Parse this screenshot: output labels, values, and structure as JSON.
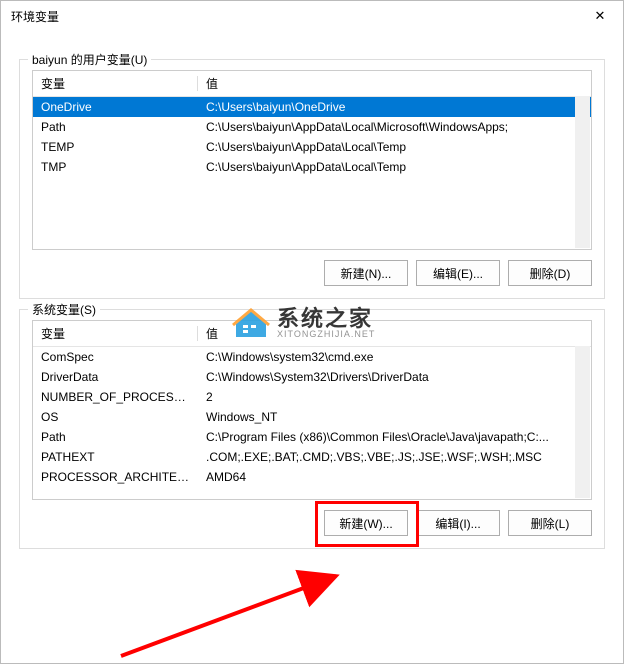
{
  "window": {
    "title": "环境变量"
  },
  "user_group": {
    "title": "baiyun 的用户变量(U)",
    "headers": {
      "var": "变量",
      "val": "值"
    },
    "rows": [
      {
        "var": "OneDrive",
        "val": "C:\\Users\\baiyun\\OneDrive",
        "selected": true
      },
      {
        "var": "Path",
        "val": "C:\\Users\\baiyun\\AppData\\Local\\Microsoft\\WindowsApps;"
      },
      {
        "var": "TEMP",
        "val": "C:\\Users\\baiyun\\AppData\\Local\\Temp"
      },
      {
        "var": "TMP",
        "val": "C:\\Users\\baiyun\\AppData\\Local\\Temp"
      }
    ],
    "buttons": {
      "new": "新建(N)...",
      "edit": "编辑(E)...",
      "del": "删除(D)"
    }
  },
  "sys_group": {
    "title": "系统变量(S)",
    "headers": {
      "var": "变量",
      "val": "值"
    },
    "rows": [
      {
        "var": "ComSpec",
        "val": "C:\\Windows\\system32\\cmd.exe"
      },
      {
        "var": "DriverData",
        "val": "C:\\Windows\\System32\\Drivers\\DriverData"
      },
      {
        "var": "NUMBER_OF_PROCESSORS",
        "val": "2"
      },
      {
        "var": "OS",
        "val": "Windows_NT"
      },
      {
        "var": "Path",
        "val": "C:\\Program Files (x86)\\Common Files\\Oracle\\Java\\javapath;C:..."
      },
      {
        "var": "PATHEXT",
        "val": ".COM;.EXE;.BAT;.CMD;.VBS;.VBE;.JS;.JSE;.WSF;.WSH;.MSC"
      },
      {
        "var": "PROCESSOR_ARCHITECT...",
        "val": "AMD64"
      }
    ],
    "buttons": {
      "new": "新建(W)...",
      "edit": "编辑(I)...",
      "del": "删除(L)"
    }
  },
  "watermark": {
    "cn": "系统之家",
    "en": "XITONGZHIJIA.NET"
  }
}
